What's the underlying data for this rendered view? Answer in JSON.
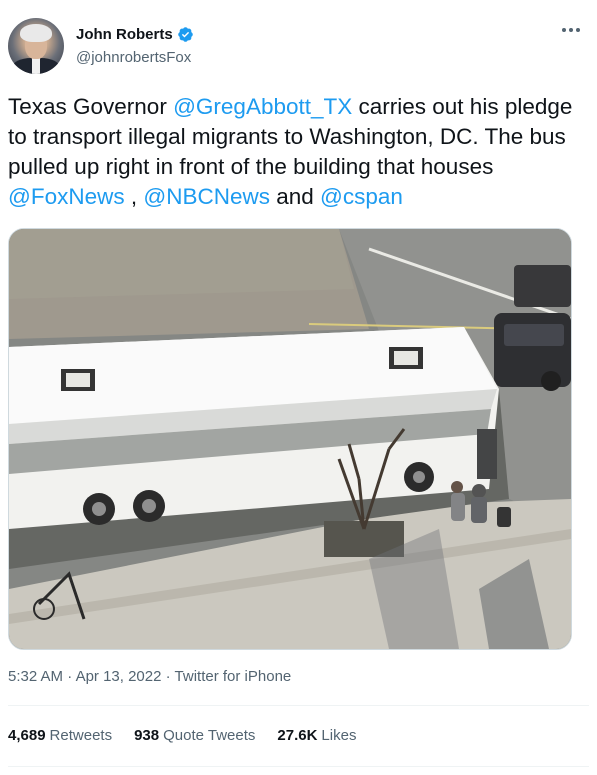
{
  "author": {
    "name": "John Roberts",
    "handle": "@johnrobertsFox",
    "verified_color": "#1d9bf0"
  },
  "tweet": {
    "segments": [
      {
        "text": "Texas Governor ",
        "mention": false
      },
      {
        "text": "@GregAbbott_TX",
        "mention": true
      },
      {
        "text": " carries out his pledge to transport illegal migrants to Washington, DC. The bus pulled up right in front of the building that houses ",
        "mention": false
      },
      {
        "text": "@FoxNews",
        "mention": true
      },
      {
        "text": " , ",
        "mention": false
      },
      {
        "text": "@NBCNews",
        "mention": true
      },
      {
        "text": " and ",
        "mention": false
      },
      {
        "text": "@cspan",
        "mention": true
      }
    ]
  },
  "meta": {
    "time": "5:32 AM",
    "date": "Apr 13, 2022",
    "source": "Twitter for iPhone",
    "separator": "·"
  },
  "stats": [
    {
      "count": "4,689",
      "label": "Retweets"
    },
    {
      "count": "938",
      "label": "Quote Tweets"
    },
    {
      "count": "27.6K",
      "label": "Likes"
    }
  ],
  "colors": {
    "link": "#1d9bf0",
    "secondary_text": "#536471",
    "primary_text": "#0f1419"
  },
  "icons": {
    "more": "more-horizontal-icon",
    "verified": "verified-badge-icon"
  }
}
